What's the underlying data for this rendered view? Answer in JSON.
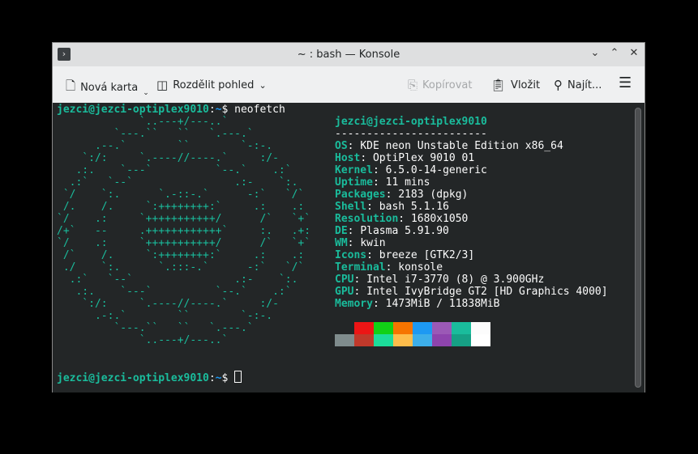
{
  "window": {
    "title": "~ : bash — Konsole"
  },
  "toolbar": {
    "new_tab": "Nová karta",
    "split_view": "Rozdělit pohled",
    "copy": "Kopírovat",
    "paste": "Vložit",
    "find": "Najít..."
  },
  "terminal": {
    "prompt_user": "jezci@jezci-optiplex9010",
    "prompt_sep": ":",
    "prompt_path": "~",
    "prompt_sign": "$",
    "command": "neofetch",
    "ascii_art": "             `..---+/---..`\n         `---.``   ``   `.---.`\n      .--.`        ``        `-:-.\n    `:/:     `.----//----.`     :/-\n   .:.    `---`          `--.`    .:`\n  .:`   `--`                .:-    `:.\n `/    `:.      `.-::-.`      -:`   `/`\n /.    /.     `:++++++++:`     .:    .:\n`/    .:     `+++++++++++/      /`   `+`\n/+`   --     .++++++++++++`     :.   .+:\n`/    .:     `+++++++++++/      /`   `+`\n /`    /.     `:++++++++:`     .:    .:\n ./    `:.      `.:::-.`      -:`   `/`\n  .:`   `--`                .:-    `:.\n   .:.    `---`          `--.`    .:`\n    `:/:     `.----//----.`     :/-\n      .-:.`        ``        `-:-.\n         `---.``   ``   `.---.`\n             `..---+/---..`",
    "header": "jezci@jezci-optiplex9010",
    "separator": "------------------------",
    "info": [
      {
        "key": "OS",
        "value": "KDE neon Unstable Edition x86_64"
      },
      {
        "key": "Host",
        "value": "OptiPlex 9010 01"
      },
      {
        "key": "Kernel",
        "value": "6.5.0-14-generic"
      },
      {
        "key": "Uptime",
        "value": "11 mins"
      },
      {
        "key": "Packages",
        "value": "2183 (dpkg)"
      },
      {
        "key": "Shell",
        "value": "bash 5.1.16"
      },
      {
        "key": "Resolution",
        "value": "1680x1050"
      },
      {
        "key": "DE",
        "value": "Plasma 5.91.90"
      },
      {
        "key": "WM",
        "value": "kwin"
      },
      {
        "key": "Icons",
        "value": "breeze [GTK2/3]"
      },
      {
        "key": "Terminal",
        "value": "konsole"
      },
      {
        "key": "CPU",
        "value": "Intel i7-3770 (8) @ 3.900GHz"
      },
      {
        "key": "GPU",
        "value": "Intel IvyBridge GT2 [HD Graphics 4000]"
      },
      {
        "key": "Memory",
        "value": "1473MiB / 11838MiB"
      }
    ],
    "palette": [
      "#232627",
      "#ed1515",
      "#11d116",
      "#f67400",
      "#1d99f3",
      "#9b59b6",
      "#1abc9c",
      "#fcfcfc",
      "#7f8c8d",
      "#c0392b",
      "#1cdc9a",
      "#fdbc4b",
      "#3daee9",
      "#8e44ad",
      "#16a085",
      "#ffffff"
    ]
  }
}
